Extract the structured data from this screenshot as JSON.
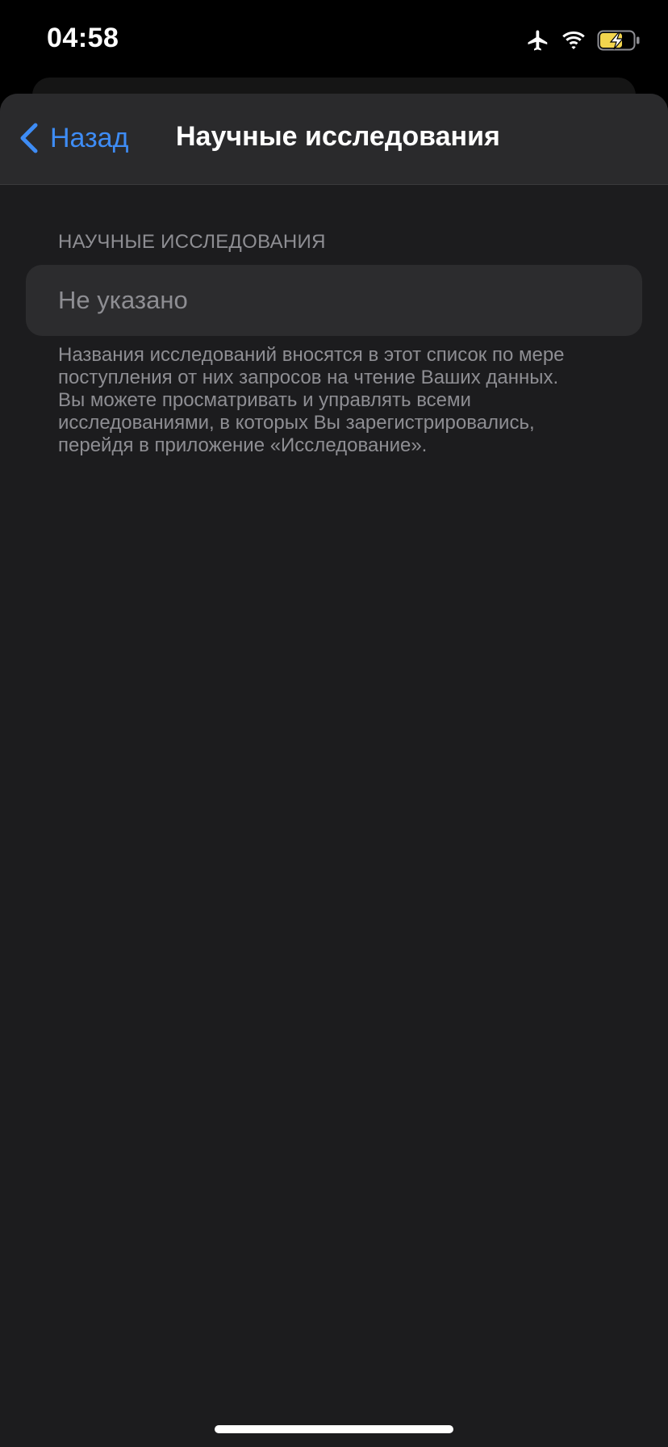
{
  "status_bar": {
    "time": "04:58",
    "icons": [
      "airplane-icon",
      "wifi-icon",
      "battery-charging-icon"
    ],
    "battery_color": "#f3d54e"
  },
  "nav": {
    "back_label": "Назад",
    "title": "Научные исследования"
  },
  "section": {
    "header": "НАУЧНЫЕ ИССЛЕДОВАНИЯ",
    "value": "Не указано",
    "footer_lines": [
      "Названия исследований вносятся в этот список по мере",
      "поступления от них запросов на чтение Ваших данных.",
      "Вы можете просматривать и управлять всеми",
      "исследованиями, в которых Вы зарегистрировались,",
      "перейдя в приложение «Исследование»."
    ]
  },
  "colors": {
    "accent": "#3e8cf5",
    "background": "#1c1c1e",
    "secondary_text": "#8e8e93"
  }
}
